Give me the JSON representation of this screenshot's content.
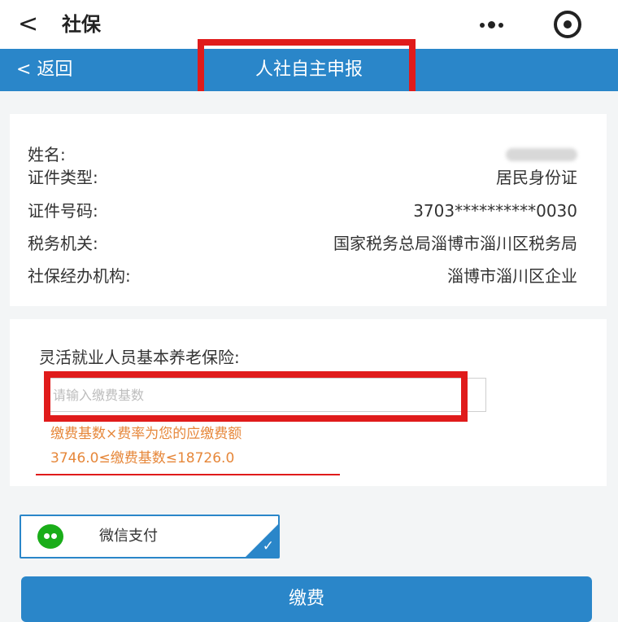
{
  "app_header": {
    "back_glyph": "<",
    "title": "社保"
  },
  "nav": {
    "back_label": "< 返回",
    "title": "人社自主申报"
  },
  "info": [
    {
      "label": "姓名:",
      "value": ""
    },
    {
      "label": "证件类型:",
      "value": "居民身份证"
    },
    {
      "label": "证件号码:",
      "value": "3703**********0030"
    },
    {
      "label": "税务机关:",
      "value": "国家税务总局淄博市淄川区税务局"
    },
    {
      "label": "社保经办机构:",
      "value": "淄博市淄川区企业"
    }
  ],
  "form": {
    "label": "灵活就业人员基本养老保险:",
    "input_placeholder": "请输入缴费基数",
    "hint_line1": "缴费基数×费率为您的应缴费额",
    "hint_line2": "3746.0≤缴费基数≤18726.0"
  },
  "payment": {
    "method_label": "微信支付",
    "selected": true,
    "check_glyph": "✓"
  },
  "submit_label": "缴费",
  "colors": {
    "primary": "#2a86c9",
    "highlight": "#e01b1b",
    "hint": "#e6873a",
    "wechat": "#1aad19"
  },
  "icons": [
    "back-chevron-icon",
    "more-icon",
    "target-icon",
    "wechat-icon",
    "check-icon"
  ]
}
